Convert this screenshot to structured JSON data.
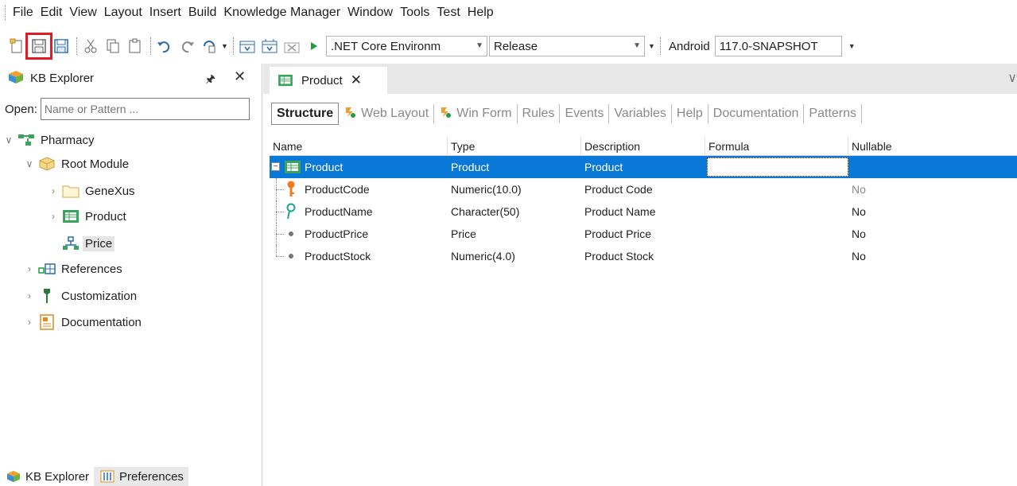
{
  "menu": [
    "File",
    "Edit",
    "View",
    "Layout",
    "Insert",
    "Build",
    "Knowledge Manager",
    "Window",
    "Tools",
    "Test",
    "Help"
  ],
  "toolbar": {
    "environment": ".NET Core Environm",
    "configuration": "Release",
    "platform_label": "Android",
    "version": "117.0-SNAPSHOT",
    "highlight_color": "#e01b24",
    "highlighted_button": "save-icon"
  },
  "kb_explorer": {
    "title": "KB Explorer",
    "open_label": "Open:",
    "open_placeholder": "Name or Pattern ...",
    "tree": {
      "root": "Pharmacy",
      "root_module": "Root Module",
      "genexus": "GeneXus",
      "product": "Product",
      "price": "Price",
      "references": "References",
      "customization": "Customization",
      "documentation": "Documentation"
    },
    "bottom_tabs": [
      "KB Explorer",
      "Preferences"
    ]
  },
  "editor": {
    "doc_tab": "Product",
    "section_tabs": [
      "Structure",
      "Web Layout",
      "Win Form",
      "Rules",
      "Events",
      "Variables",
      "Help",
      "Documentation",
      "Patterns"
    ],
    "active_section": "Structure",
    "selection_color": "#0a78d7",
    "columns": [
      "Name",
      "Type",
      "Description",
      "Formula",
      "Nullable"
    ],
    "rows": [
      {
        "name": "Product",
        "type": "Product",
        "description": "Product",
        "formula": "",
        "nullable": ""
      },
      {
        "name": "ProductCode",
        "type": "Numeric(10.0)",
        "description": "Product Code",
        "formula": "",
        "nullable": "No"
      },
      {
        "name": "ProductName",
        "type": "Character(50)",
        "description": "Product Name",
        "formula": "",
        "nullable": "No"
      },
      {
        "name": "ProductPrice",
        "type": "Price",
        "description": "Product Price",
        "formula": "",
        "nullable": "No"
      },
      {
        "name": "ProductStock",
        "type": "Numeric(4.0)",
        "description": "Product Stock",
        "formula": "",
        "nullable": "No"
      }
    ]
  }
}
